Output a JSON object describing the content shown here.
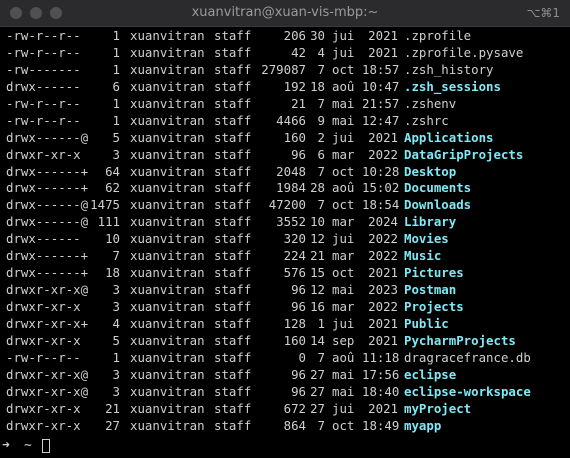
{
  "window": {
    "title": "xuanvitran@xuan-vis-mbp:~",
    "shortcut": "⌥⌘1"
  },
  "colors": {
    "background": "#000000",
    "text": "#cfcfcf",
    "directory": "#7fe9f5",
    "titlebar": "#2b2b2d"
  },
  "rows": [
    {
      "perm": "-rw-r--r--",
      "links": "1",
      "owner": "xuanvitran",
      "group": "staff",
      "size": "206",
      "day": "30",
      "month": "jui",
      "time": "2021",
      "name": "zprofile",
      "display": ".zprofile",
      "is_dir": false
    },
    {
      "perm": "-rw-r--r--",
      "links": "1",
      "owner": "xuanvitran",
      "group": "staff",
      "size": "42",
      "day": "4",
      "month": "jui",
      "time": "2021",
      "display": ".zprofile.pysave",
      "is_dir": false
    },
    {
      "perm": "-rw-------",
      "links": "1",
      "owner": "xuanvitran",
      "group": "staff",
      "size": "279087",
      "day": "7",
      "month": "oct",
      "time": "18:57",
      "display": ".zsh_history",
      "is_dir": false
    },
    {
      "perm": "drwx------",
      "links": "6",
      "owner": "xuanvitran",
      "group": "staff",
      "size": "192",
      "day": "18",
      "month": "aoû",
      "time": "10:47",
      "display": ".zsh_sessions",
      "is_dir": true
    },
    {
      "perm": "-rw-r--r--",
      "links": "1",
      "owner": "xuanvitran",
      "group": "staff",
      "size": "21",
      "day": "7",
      "month": "mai",
      "time": "21:57",
      "display": ".zshenv",
      "is_dir": false
    },
    {
      "perm": "-rw-r--r--",
      "links": "1",
      "owner": "xuanvitran",
      "group": "staff",
      "size": "4466",
      "day": "9",
      "month": "mai",
      "time": "12:47",
      "display": ".zshrc",
      "is_dir": false
    },
    {
      "perm": "drwx------@",
      "links": "5",
      "owner": "xuanvitran",
      "group": "staff",
      "size": "160",
      "day": "2",
      "month": "jui",
      "time": "2021",
      "display": "Applications",
      "is_dir": true
    },
    {
      "perm": "drwxr-xr-x",
      "links": "3",
      "owner": "xuanvitran",
      "group": "staff",
      "size": "96",
      "day": "6",
      "month": "mar",
      "time": "2022",
      "display": "DataGripProjects",
      "is_dir": true
    },
    {
      "perm": "drwx------+",
      "links": "64",
      "owner": "xuanvitran",
      "group": "staff",
      "size": "2048",
      "day": "7",
      "month": "oct",
      "time": "10:28",
      "display": "Desktop",
      "is_dir": true
    },
    {
      "perm": "drwx------+",
      "links": "62",
      "owner": "xuanvitran",
      "group": "staff",
      "size": "1984",
      "day": "28",
      "month": "aoû",
      "time": "15:02",
      "display": "Documents",
      "is_dir": true
    },
    {
      "perm": "drwx------@",
      "links": "1475",
      "owner": "xuanvitran",
      "group": "staff",
      "size": "47200",
      "day": "7",
      "month": "oct",
      "time": "18:54",
      "display": "Downloads",
      "is_dir": true
    },
    {
      "perm": "drwx------@",
      "links": "111",
      "owner": "xuanvitran",
      "group": "staff",
      "size": "3552",
      "day": "10",
      "month": "mar",
      "time": "2024",
      "display": "Library",
      "is_dir": true
    },
    {
      "perm": "drwx------",
      "links": "10",
      "owner": "xuanvitran",
      "group": "staff",
      "size": "320",
      "day": "12",
      "month": "jui",
      "time": "2022",
      "display": "Movies",
      "is_dir": true
    },
    {
      "perm": "drwx------+",
      "links": "7",
      "owner": "xuanvitran",
      "group": "staff",
      "size": "224",
      "day": "21",
      "month": "mar",
      "time": "2022",
      "display": "Music",
      "is_dir": true
    },
    {
      "perm": "drwx------+",
      "links": "18",
      "owner": "xuanvitran",
      "group": "staff",
      "size": "576",
      "day": "15",
      "month": "oct",
      "time": "2021",
      "display": "Pictures",
      "is_dir": true
    },
    {
      "perm": "drwxr-xr-x@",
      "links": "3",
      "owner": "xuanvitran",
      "group": "staff",
      "size": "96",
      "day": "12",
      "month": "mai",
      "time": "2023",
      "display": "Postman",
      "is_dir": true
    },
    {
      "perm": "drwxr-xr-x",
      "links": "3",
      "owner": "xuanvitran",
      "group": "staff",
      "size": "96",
      "day": "16",
      "month": "mar",
      "time": "2022",
      "display": "Projects",
      "is_dir": true
    },
    {
      "perm": "drwxr-xr-x+",
      "links": "4",
      "owner": "xuanvitran",
      "group": "staff",
      "size": "128",
      "day": "1",
      "month": "jui",
      "time": "2021",
      "display": "Public",
      "is_dir": true
    },
    {
      "perm": "drwxr-xr-x",
      "links": "5",
      "owner": "xuanvitran",
      "group": "staff",
      "size": "160",
      "day": "14",
      "month": "sep",
      "time": "2021",
      "display": "PycharmProjects",
      "is_dir": true
    },
    {
      "perm": "-rw-r--r--",
      "links": "1",
      "owner": "xuanvitran",
      "group": "staff",
      "size": "0",
      "day": "7",
      "month": "aoû",
      "time": "11:18",
      "display": "dragracefrance.db",
      "is_dir": false
    },
    {
      "perm": "drwxr-xr-x@",
      "links": "3",
      "owner": "xuanvitran",
      "group": "staff",
      "size": "96",
      "day": "27",
      "month": "mai",
      "time": "17:56",
      "display": "eclipse",
      "is_dir": true
    },
    {
      "perm": "drwxr-xr-x@",
      "links": "3",
      "owner": "xuanvitran",
      "group": "staff",
      "size": "96",
      "day": "27",
      "month": "mai",
      "time": "18:40",
      "display": "eclipse-workspace",
      "is_dir": true
    },
    {
      "perm": "drwxr-xr-x",
      "links": "21",
      "owner": "xuanvitran",
      "group": "staff",
      "size": "672",
      "day": "27",
      "month": "jui",
      "time": "2021",
      "display": "myProject",
      "is_dir": true
    },
    {
      "perm": "drwxr-xr-x",
      "links": "27",
      "owner": "xuanvitran",
      "group": "staff",
      "size": "864",
      "day": "7",
      "month": "oct",
      "time": "18:49",
      "display": "myapp",
      "is_dir": true
    }
  ],
  "prompt": {
    "arrow": "➜",
    "cwd": "~"
  }
}
